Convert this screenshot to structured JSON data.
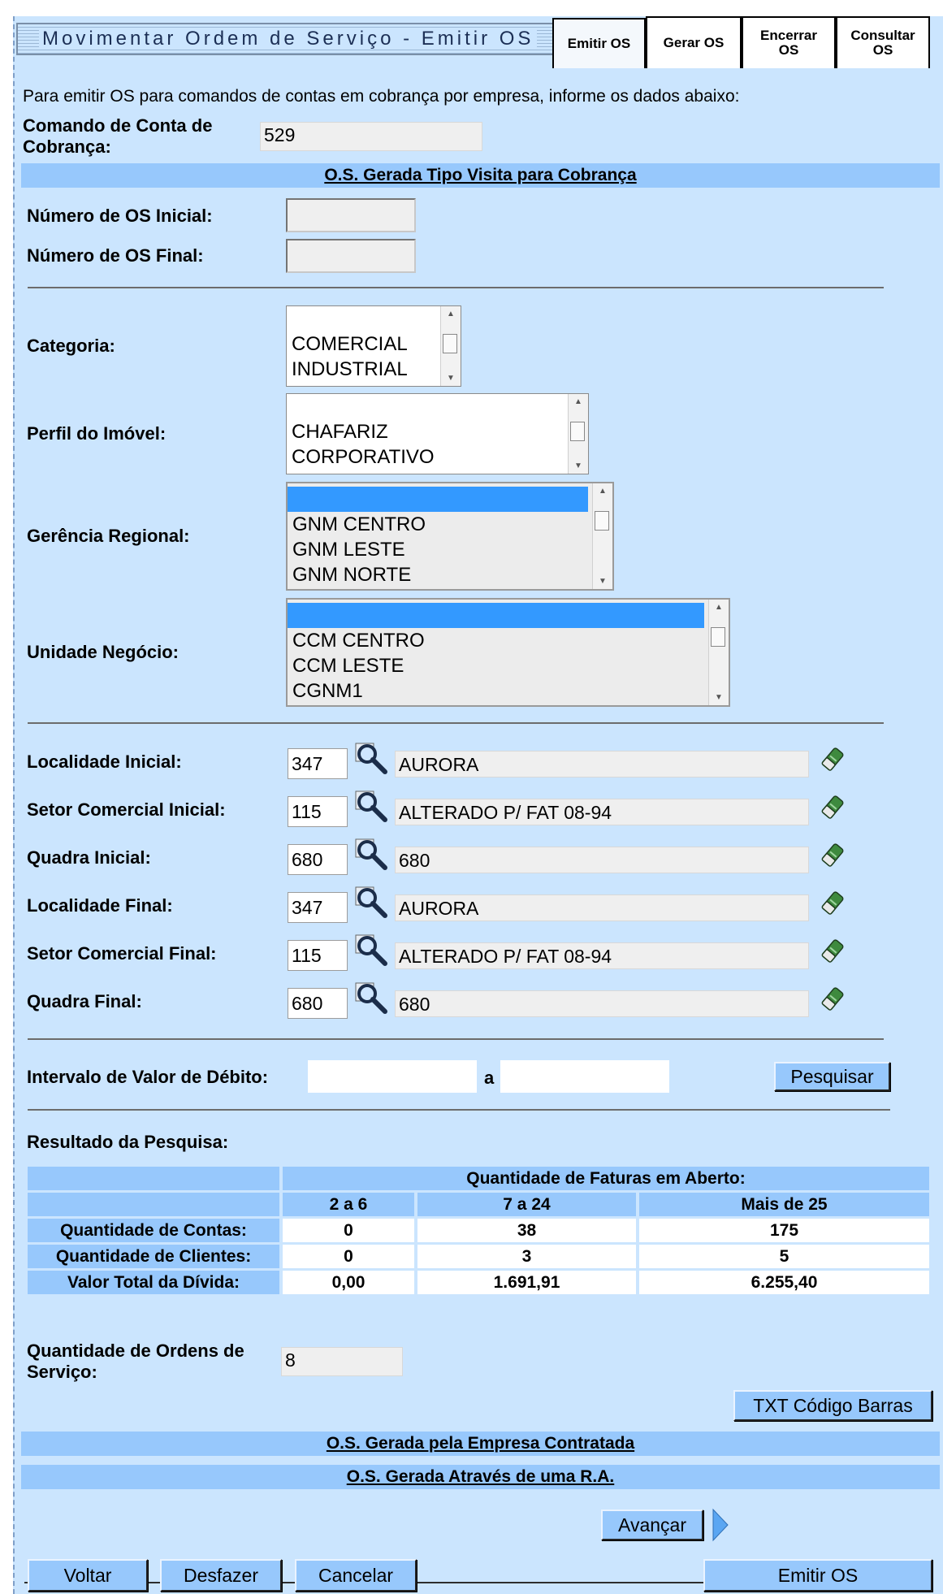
{
  "header": {
    "title": "Movimentar Ordem de Serviço - Emitir OS",
    "tabs": [
      {
        "label": "Emitir OS"
      },
      {
        "label": "Gerar OS"
      },
      {
        "label": "Encerrar OS"
      },
      {
        "label": "Consultar OS"
      }
    ]
  },
  "intro": "Para emitir OS para comandos de contas em cobrança por empresa, informe os dados abaixo:",
  "comando": {
    "label": "Comando de Conta de Cobrança:",
    "value": "529"
  },
  "section1": "O.S. Gerada Tipo Visita para Cobrança",
  "os_inicial": {
    "label": "Número de OS Inicial:",
    "value": ""
  },
  "os_final": {
    "label": "Número de OS Final:",
    "value": ""
  },
  "categoria": {
    "label": "Categoria:",
    "options": [
      "",
      "COMERCIAL",
      "INDUSTRIAL"
    ]
  },
  "perfil": {
    "label": "Perfil do Imóvel:",
    "options": [
      "",
      "CHAFARIZ",
      "CORPORATIVO"
    ]
  },
  "gerencia": {
    "label": "Gerência Regional:",
    "options": [
      "",
      "GNM CENTRO",
      "GNM LESTE",
      "GNM NORTE"
    ]
  },
  "unidade": {
    "label": "Unidade Negócio:",
    "options": [
      "",
      "CCM CENTRO",
      "CCM LESTE",
      "CGNM1"
    ]
  },
  "locs": [
    {
      "label": "Localidade Inicial:",
      "code": "347",
      "desc": "AURORA"
    },
    {
      "label": "Setor Comercial Inicial:",
      "code": "115",
      "desc": "ALTERADO P/ FAT 08-94"
    },
    {
      "label": "Quadra Inicial:",
      "code": "680",
      "desc": "680"
    },
    {
      "label": "Localidade Final:",
      "code": "347",
      "desc": "AURORA"
    },
    {
      "label": "Setor Comercial Final:",
      "code": "115",
      "desc": "ALTERADO P/ FAT 08-94"
    },
    {
      "label": "Quadra Final:",
      "code": "680",
      "desc": "680"
    }
  ],
  "intervalo": {
    "label": "Intervalo de Valor de Débito:",
    "sep": "a",
    "from": "",
    "to": "",
    "button": "Pesquisar"
  },
  "resultado": {
    "label": "Resultado da Pesquisa:",
    "group_header": "Quantidade de Faturas em Aberto:",
    "columns": [
      "2 a 6",
      "7 a 24",
      "Mais de 25"
    ],
    "rows": [
      {
        "label": "Quantidade de Contas:",
        "values": [
          "0",
          "38",
          "175"
        ]
      },
      {
        "label": "Quantidade de Clientes:",
        "values": [
          "0",
          "3",
          "5"
        ]
      },
      {
        "label": "Valor Total da Dívida:",
        "values": [
          "0,00",
          "1.691,91",
          "6.255,40"
        ]
      }
    ]
  },
  "qtd_ordens": {
    "label": "Quantidade de Ordens de Serviço:",
    "value": "8"
  },
  "txt_button": "TXT Código Barras",
  "section2": "O.S. Gerada pela Empresa Contratada",
  "section3": "O.S. Gerada Através de uma R.A.",
  "avancar": "Avançar",
  "footer": {
    "voltar": "Voltar",
    "desfazer": "Desfazer",
    "cancelar": "Cancelar",
    "emitir": "Emitir OS"
  },
  "colors": {
    "panel": "#cbe5fe",
    "bar": "#97c8fc",
    "selected": "#3399ff"
  }
}
